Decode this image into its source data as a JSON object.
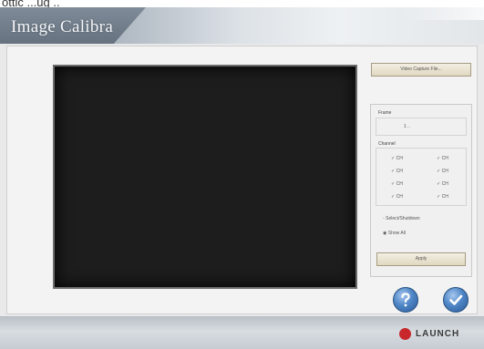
{
  "page": {
    "top_text": "ottic ...ug .."
  },
  "window": {
    "title": "Image Calibra"
  },
  "capture": {
    "button_label": "Video Capture File..."
  },
  "settings": {
    "frame_group_title": "Frame",
    "frame_value": "1  ..",
    "channel_group_title": "Channel",
    "channels": [
      {
        "label": "CH"
      },
      {
        "label": "CH"
      },
      {
        "label": "CH"
      },
      {
        "label": "CH"
      },
      {
        "label": "CH"
      },
      {
        "label": "CH"
      },
      {
        "label": "CH"
      },
      {
        "label": "CH"
      }
    ],
    "option_1": "Select/Shutdown",
    "option_2": "Show All",
    "apply_label": "Apply"
  },
  "footer": {
    "brand": "LAUNCH",
    "brand_color": "#c8282b"
  }
}
